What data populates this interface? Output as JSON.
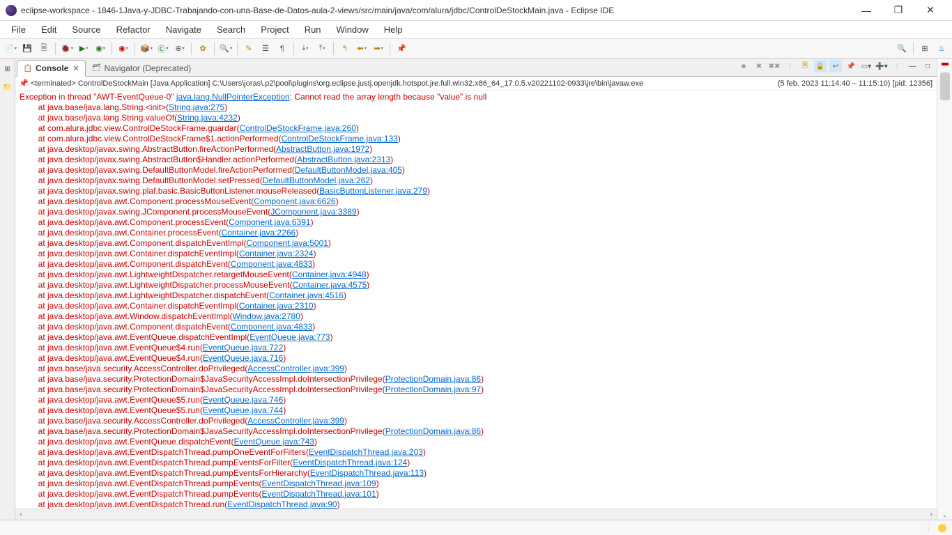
{
  "window": {
    "title": "eclipse-workspace - 1846-1Java-y-JDBC-Trabajando-con-una-Base-de-Datos-aula-2-views/src/main/java/com/alura/jdbc/ControlDeStockMain.java - Eclipse IDE"
  },
  "menu": {
    "items": [
      "File",
      "Edit",
      "Source",
      "Refactor",
      "Navigate",
      "Search",
      "Project",
      "Run",
      "Window",
      "Help"
    ]
  },
  "tabs": {
    "console": {
      "label": "Console",
      "icon": "📋"
    },
    "navigator": {
      "label": "Navigator (Deprecated)",
      "icon": "🗂"
    }
  },
  "process": {
    "prefix": "<terminated> ControlDeStockMain [Java Application] C:\\Users\\joras\\.p2\\pool\\plugins\\org.eclipse.justj.openjdk.hotspot.jre.full.win32.x86_64_17.0.5.v20221102-0933\\jre\\bin\\javaw.exe",
    "suffix": "(5 feb. 2023 11:14:40 – 11:15:10) [pid: 12356]"
  },
  "stack": {
    "header_pre": "Exception in thread \"AWT-EventQueue-0\" ",
    "header_link": "java.lang.NullPointerException",
    "header_post": ": Cannot read the array length because \"value\" is null",
    "lines": [
      {
        "pre": "\tat java.base/java.lang.String.<init>(",
        "link": "String.java:275",
        "post": ")"
      },
      {
        "pre": "\tat java.base/java.lang.String.valueOf(",
        "link": "String.java:4232",
        "post": ")"
      },
      {
        "pre": "\tat com.alura.jdbc.view.ControlDeStockFrame.guardar(",
        "link": "ControlDeStockFrame.java:260",
        "post": ")"
      },
      {
        "pre": "\tat com.alura.jdbc.view.ControlDeStockFrame$1.actionPerformed(",
        "link": "ControlDeStockFrame.java:133",
        "post": ")"
      },
      {
        "pre": "\tat java.desktop/javax.swing.AbstractButton.fireActionPerformed(",
        "link": "AbstractButton.java:1972",
        "post": ")"
      },
      {
        "pre": "\tat java.desktop/javax.swing.AbstractButton$Handler.actionPerformed(",
        "link": "AbstractButton.java:2313",
        "post": ")"
      },
      {
        "pre": "\tat java.desktop/javax.swing.DefaultButtonModel.fireActionPerformed(",
        "link": "DefaultButtonModel.java:405",
        "post": ")"
      },
      {
        "pre": "\tat java.desktop/javax.swing.DefaultButtonModel.setPressed(",
        "link": "DefaultButtonModel.java:262",
        "post": ")"
      },
      {
        "pre": "\tat java.desktop/javax.swing.plaf.basic.BasicButtonListener.mouseReleased(",
        "link": "BasicButtonListener.java:279",
        "post": ")"
      },
      {
        "pre": "\tat java.desktop/java.awt.Component.processMouseEvent(",
        "link": "Component.java:6626",
        "post": ")"
      },
      {
        "pre": "\tat java.desktop/javax.swing.JComponent.processMouseEvent(",
        "link": "JComponent.java:3389",
        "post": ")"
      },
      {
        "pre": "\tat java.desktop/java.awt.Component.processEvent(",
        "link": "Component.java:6391",
        "post": ")"
      },
      {
        "pre": "\tat java.desktop/java.awt.Container.processEvent(",
        "link": "Container.java:2266",
        "post": ")"
      },
      {
        "pre": "\tat java.desktop/java.awt.Component.dispatchEventImpl(",
        "link": "Component.java:5001",
        "post": ")"
      },
      {
        "pre": "\tat java.desktop/java.awt.Container.dispatchEventImpl(",
        "link": "Container.java:2324",
        "post": ")"
      },
      {
        "pre": "\tat java.desktop/java.awt.Component.dispatchEvent(",
        "link": "Component.java:4833",
        "post": ")"
      },
      {
        "pre": "\tat java.desktop/java.awt.LightweightDispatcher.retargetMouseEvent(",
        "link": "Container.java:4948",
        "post": ")"
      },
      {
        "pre": "\tat java.desktop/java.awt.LightweightDispatcher.processMouseEvent(",
        "link": "Container.java:4575",
        "post": ")"
      },
      {
        "pre": "\tat java.desktop/java.awt.LightweightDispatcher.dispatchEvent(",
        "link": "Container.java:4516",
        "post": ")"
      },
      {
        "pre": "\tat java.desktop/java.awt.Container.dispatchEventImpl(",
        "link": "Container.java:2310",
        "post": ")"
      },
      {
        "pre": "\tat java.desktop/java.awt.Window.dispatchEventImpl(",
        "link": "Window.java:2780",
        "post": ")"
      },
      {
        "pre": "\tat java.desktop/java.awt.Component.dispatchEvent(",
        "link": "Component.java:4833",
        "post": ")"
      },
      {
        "pre": "\tat java.desktop/java.awt.EventQueue.dispatchEventImpl(",
        "link": "EventQueue.java:773",
        "post": ")"
      },
      {
        "pre": "\tat java.desktop/java.awt.EventQueue$4.run(",
        "link": "EventQueue.java:722",
        "post": ")"
      },
      {
        "pre": "\tat java.desktop/java.awt.EventQueue$4.run(",
        "link": "EventQueue.java:716",
        "post": ")"
      },
      {
        "pre": "\tat java.base/java.security.AccessController.doPrivileged(",
        "link": "AccessController.java:399",
        "post": ")"
      },
      {
        "pre": "\tat java.base/java.security.ProtectionDomain$JavaSecurityAccessImpl.doIntersectionPrivilege(",
        "link": "ProtectionDomain.java:86",
        "post": ")"
      },
      {
        "pre": "\tat java.base/java.security.ProtectionDomain$JavaSecurityAccessImpl.doIntersectionPrivilege(",
        "link": "ProtectionDomain.java:97",
        "post": ")"
      },
      {
        "pre": "\tat java.desktop/java.awt.EventQueue$5.run(",
        "link": "EventQueue.java:746",
        "post": ")"
      },
      {
        "pre": "\tat java.desktop/java.awt.EventQueue$5.run(",
        "link": "EventQueue.java:744",
        "post": ")"
      },
      {
        "pre": "\tat java.base/java.security.AccessController.doPrivileged(",
        "link": "AccessController.java:399",
        "post": ")"
      },
      {
        "pre": "\tat java.base/java.security.ProtectionDomain$JavaSecurityAccessImpl.doIntersectionPrivilege(",
        "link": "ProtectionDomain.java:86",
        "post": ")"
      },
      {
        "pre": "\tat java.desktop/java.awt.EventQueue.dispatchEvent(",
        "link": "EventQueue.java:743",
        "post": ")"
      },
      {
        "pre": "\tat java.desktop/java.awt.EventDispatchThread.pumpOneEventForFilters(",
        "link": "EventDispatchThread.java:203",
        "post": ")"
      },
      {
        "pre": "\tat java.desktop/java.awt.EventDispatchThread.pumpEventsForFilter(",
        "link": "EventDispatchThread.java:124",
        "post": ")"
      },
      {
        "pre": "\tat java.desktop/java.awt.EventDispatchThread.pumpEventsForHierarchy(",
        "link": "EventDispatchThread.java:113",
        "post": ")"
      },
      {
        "pre": "\tat java.desktop/java.awt.EventDispatchThread.pumpEvents(",
        "link": "EventDispatchThread.java:109",
        "post": ")"
      },
      {
        "pre": "\tat java.desktop/java.awt.EventDispatchThread.pumpEvents(",
        "link": "EventDispatchThread.java:101",
        "post": ")"
      },
      {
        "pre": "\tat java.desktop/java.awt.EventDispatchThread.run(",
        "link": "EventDispatchThread.java:90",
        "post": ")"
      }
    ]
  }
}
